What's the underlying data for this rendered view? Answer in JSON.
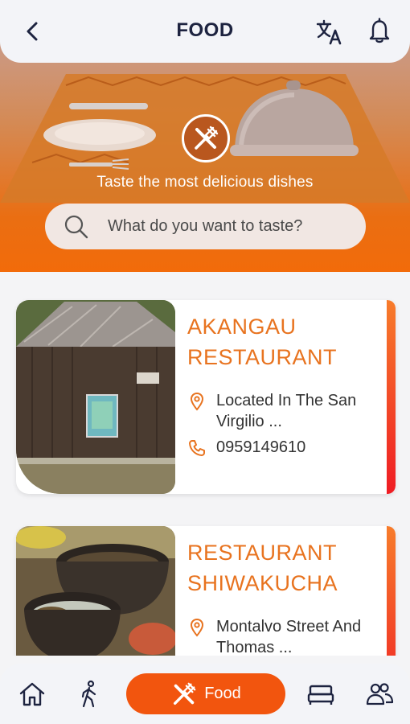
{
  "header": {
    "title": "FOOD",
    "back_icon": "chevron-left-icon",
    "translate_icon": "translate-icon",
    "notifications_icon": "bell-icon"
  },
  "hero": {
    "tagline": "Taste the most delicious dishes",
    "logo_icon": "cutlery-icon"
  },
  "search": {
    "placeholder": "What do you want to taste?",
    "icon": "search-icon"
  },
  "restaurants": [
    {
      "name": "AKANGAU RESTAURANT",
      "address": "Located In The San Virgilio ...",
      "phone": "0959149610"
    },
    {
      "name": "RESTAURANT SHIWAKUCHA",
      "address": "Montalvo Street And Thomas ...",
      "phone": ""
    }
  ],
  "bottom_nav": {
    "items": [
      {
        "icon": "home-icon",
        "label": ""
      },
      {
        "icon": "walking-icon",
        "label": ""
      },
      {
        "icon": "cutlery-icon",
        "label": "Food"
      },
      {
        "icon": "bed-icon",
        "label": ""
      },
      {
        "icon": "people-icon",
        "label": ""
      }
    ]
  },
  "colors": {
    "accent": "#f2550e",
    "title_text": "#1d2340",
    "card_title": "#e8731f"
  }
}
